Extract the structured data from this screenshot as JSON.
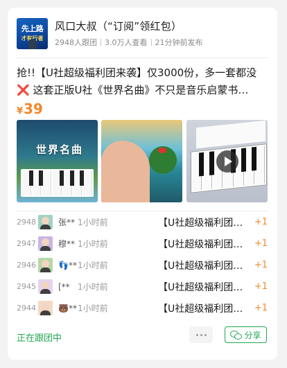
{
  "account": {
    "logo_text_top": "先上路",
    "logo_text_bottom": "才有行者",
    "title": "风口大叔（“订阅”领红包）",
    "followers": "2948人跟团",
    "views": "3.0万人查看",
    "posted": "21分钟前发布"
  },
  "post": {
    "line1": "抢!!【U社超级福利团来袭】仅3000份，多一套都没",
    "line2": "❌ 这套正版U社《世界名曲》不只是音乐启蒙书…",
    "price_currency": "¥",
    "price_value": "39",
    "thumb1_title": "世界名曲"
  },
  "orders": [
    {
      "index": "2948",
      "name": "张**",
      "time": "1小时前",
      "title": "【U社超级福利团…",
      "qty": "+1",
      "avatar_color": "#9fd3c7"
    },
    {
      "index": "2947",
      "name": "穆**",
      "time": "1小时前",
      "title": "【U社超级福利团…",
      "qty": "+1",
      "avatar_color": "#c9b6e4"
    },
    {
      "index": "2946",
      "name": "👣**",
      "time": "1小时前",
      "title": "【U社超级福利团…",
      "qty": "+1",
      "avatar_color": "#b7d7a8"
    },
    {
      "index": "2945",
      "name": "[**",
      "time": "1小时前",
      "title": "【U社超级福利团…",
      "qty": "+1",
      "avatar_color": "#e6d3f0"
    },
    {
      "index": "2944",
      "name": "🐻**",
      "time": "1小时前",
      "title": "【U社超级福利团…",
      "qty": "+1",
      "avatar_color": "#f4d9c6"
    }
  ],
  "footer": {
    "status": "正在跟团中",
    "share_label": "分享"
  },
  "colors": {
    "accent_green": "#21a852",
    "price_orange": "#f5862a"
  }
}
